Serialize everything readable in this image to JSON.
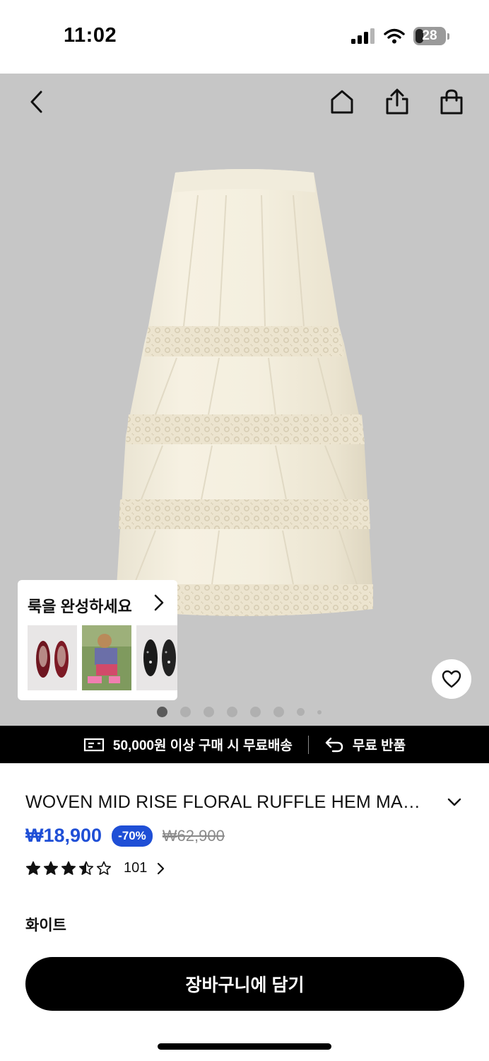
{
  "status_bar": {
    "time": "11:02",
    "battery": "28",
    "battery_level": 0.28
  },
  "look": {
    "title": "룩을 완성하세요"
  },
  "carousel": {
    "count": 8,
    "active_index": 0
  },
  "shipping": {
    "free_shipping": "50,000원 이상 구매 시 무료배송",
    "free_return": "무료 반품"
  },
  "product": {
    "title": "WOVEN MID RISE FLORAL RUFFLE HEM MAXI SKIRT",
    "price": "₩18,900",
    "discount": "-70%",
    "original_price": "₩62,900",
    "rating": 3.5,
    "review_count": "101",
    "color": "화이트"
  },
  "cta": {
    "add_to_cart": "장바구니에 담기"
  },
  "colors": {
    "accent": "#1f4fd6",
    "hero_bg": "#c6c6c6",
    "banner_bg": "#000000"
  },
  "icons": [
    "back-icon",
    "home-icon",
    "share-icon",
    "bag-icon",
    "heart-icon",
    "truck-icon",
    "return-icon",
    "chevron-down-icon",
    "chevron-right-icon",
    "star-icon"
  ]
}
